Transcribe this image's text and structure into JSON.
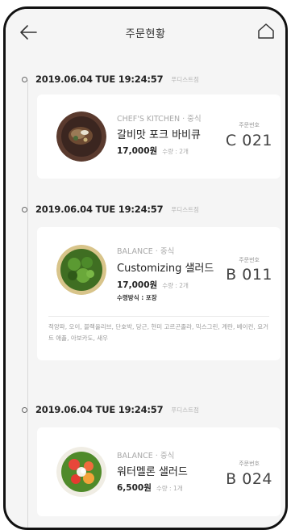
{
  "header": {
    "title": "주문현황",
    "back_icon": "arrow-left-icon",
    "home_icon": "home-icon"
  },
  "orders": [
    {
      "datetime": "2019.06.04 TUE 19:24:57",
      "store": "푸디스트점",
      "category": "CHEF'S KITCHEN · 중식",
      "name": "갈비맛 포크 바비큐",
      "price": "17,000원",
      "qty": "수량 : 2개",
      "order_no_label": "주문번호",
      "order_no": "C 021",
      "image": "pork-bbq-dish"
    },
    {
      "datetime": "2019.06.04 TUE 19:24:57",
      "store": "푸디스트점",
      "category": "BALANCE · 중식",
      "name": "Customizing 샐러드",
      "price": "17,000원",
      "qty": "수량 : 2개",
      "option": "수령방식 : 포장",
      "order_no_label": "주문번호",
      "order_no": "B 011",
      "ingredients": "적양파, 오이, 블랙올리브, 단호박, 당근, 현미 고르곤졸라, 믹스그린, 계란, 베이컨, 요거트 애플, 아보카도, 새우",
      "image": "custom-salad-dish"
    },
    {
      "datetime": "2019.06.04 TUE 19:24:57",
      "store": "푸디스트점",
      "category": "BALANCE · 중식",
      "name": "워터멜론 샐러드",
      "price": "6,500원",
      "qty": "수량 : 1개",
      "order_no_label": "주문번호",
      "order_no": "B 024",
      "image": "watermelon-salad-dish"
    }
  ]
}
